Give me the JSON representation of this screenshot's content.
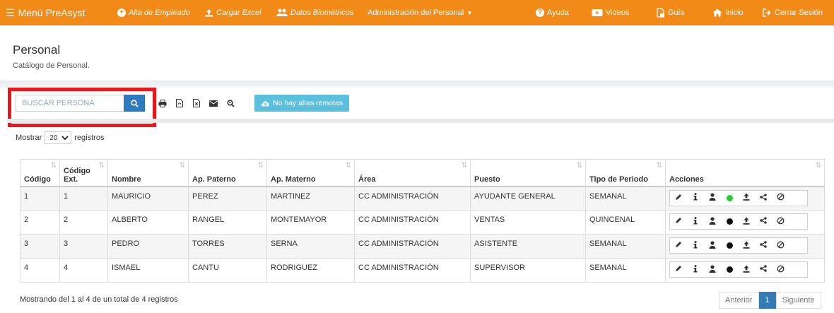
{
  "navbar": {
    "brand": "Menú PreAsyst",
    "items": [
      {
        "label": "Alta de Empleado",
        "icon": "plus-circle-icon"
      },
      {
        "label": "Cargar Excel",
        "icon": "upload-icon"
      },
      {
        "label": "Datos Biométricos",
        "icon": "users-icon"
      },
      {
        "label": "Administración del Personal",
        "icon": "caret-down-icon"
      },
      {
        "label": "Ayuda",
        "icon": "question-circle-icon"
      },
      {
        "label": "Videos",
        "icon": "video-icon"
      },
      {
        "label": "Guia",
        "icon": "file-guide-icon"
      },
      {
        "label": "Inicio",
        "icon": "home-icon"
      },
      {
        "label": "Cerrar Sesión",
        "icon": "sign-out-icon"
      }
    ],
    "color": "#f28a18"
  },
  "header": {
    "title": "Personal",
    "subtitle": "Catálogo de Personal."
  },
  "toolbar": {
    "search_placeholder": "BUSCAR PERSONA",
    "remote_label": "No hay altas remotas"
  },
  "length": {
    "prefix": "Mostrar",
    "value": "20",
    "suffix": "registros"
  },
  "table": {
    "columns": [
      "Código",
      "Código Ext.",
      "Nombre",
      "Ap. Paterno",
      "Ap. Materno",
      "Área",
      "Puesto",
      "Tipo de Periodo",
      "Acciones"
    ],
    "rows": [
      {
        "codigo": "1",
        "ext": "1",
        "nombre": "MAURICIO",
        "paterno": "PEREZ",
        "materno": "MARTINEZ",
        "area": "CC ADMINISTRACIÓN",
        "puesto": "AYUDANTE GENERAL",
        "periodo": "SEMANAL",
        "status": "active"
      },
      {
        "codigo": "2",
        "ext": "2",
        "nombre": "ALBERTO",
        "paterno": "RANGEL",
        "materno": "MONTEMAYOR",
        "area": "CC ADMINISTRACIÓN",
        "puesto": "VENTAS",
        "periodo": "QUINCENAL",
        "status": "inactive"
      },
      {
        "codigo": "3",
        "ext": "3",
        "nombre": "PEDRO",
        "paterno": "TORRES",
        "materno": "SERNA",
        "area": "CC ADMINISTRACIÓN",
        "puesto": "ASISTENTE",
        "periodo": "SEMANAL",
        "status": "inactive"
      },
      {
        "codigo": "4",
        "ext": "4",
        "nombre": "ISMAEL",
        "paterno": "CANTU",
        "materno": "RODRIGUEZ",
        "area": "CC ADMINISTRACIÓN",
        "puesto": "SUPERVISOR",
        "periodo": "SEMANAL",
        "status": "inactive"
      }
    ],
    "status_colors": {
      "active": "#22cc33",
      "inactive": "#111111"
    }
  },
  "footer": {
    "info": "Mostrando del 1 al 4 de un total de 4 registros",
    "prev": "Anterior",
    "page": "1",
    "next": "Siguiente"
  }
}
